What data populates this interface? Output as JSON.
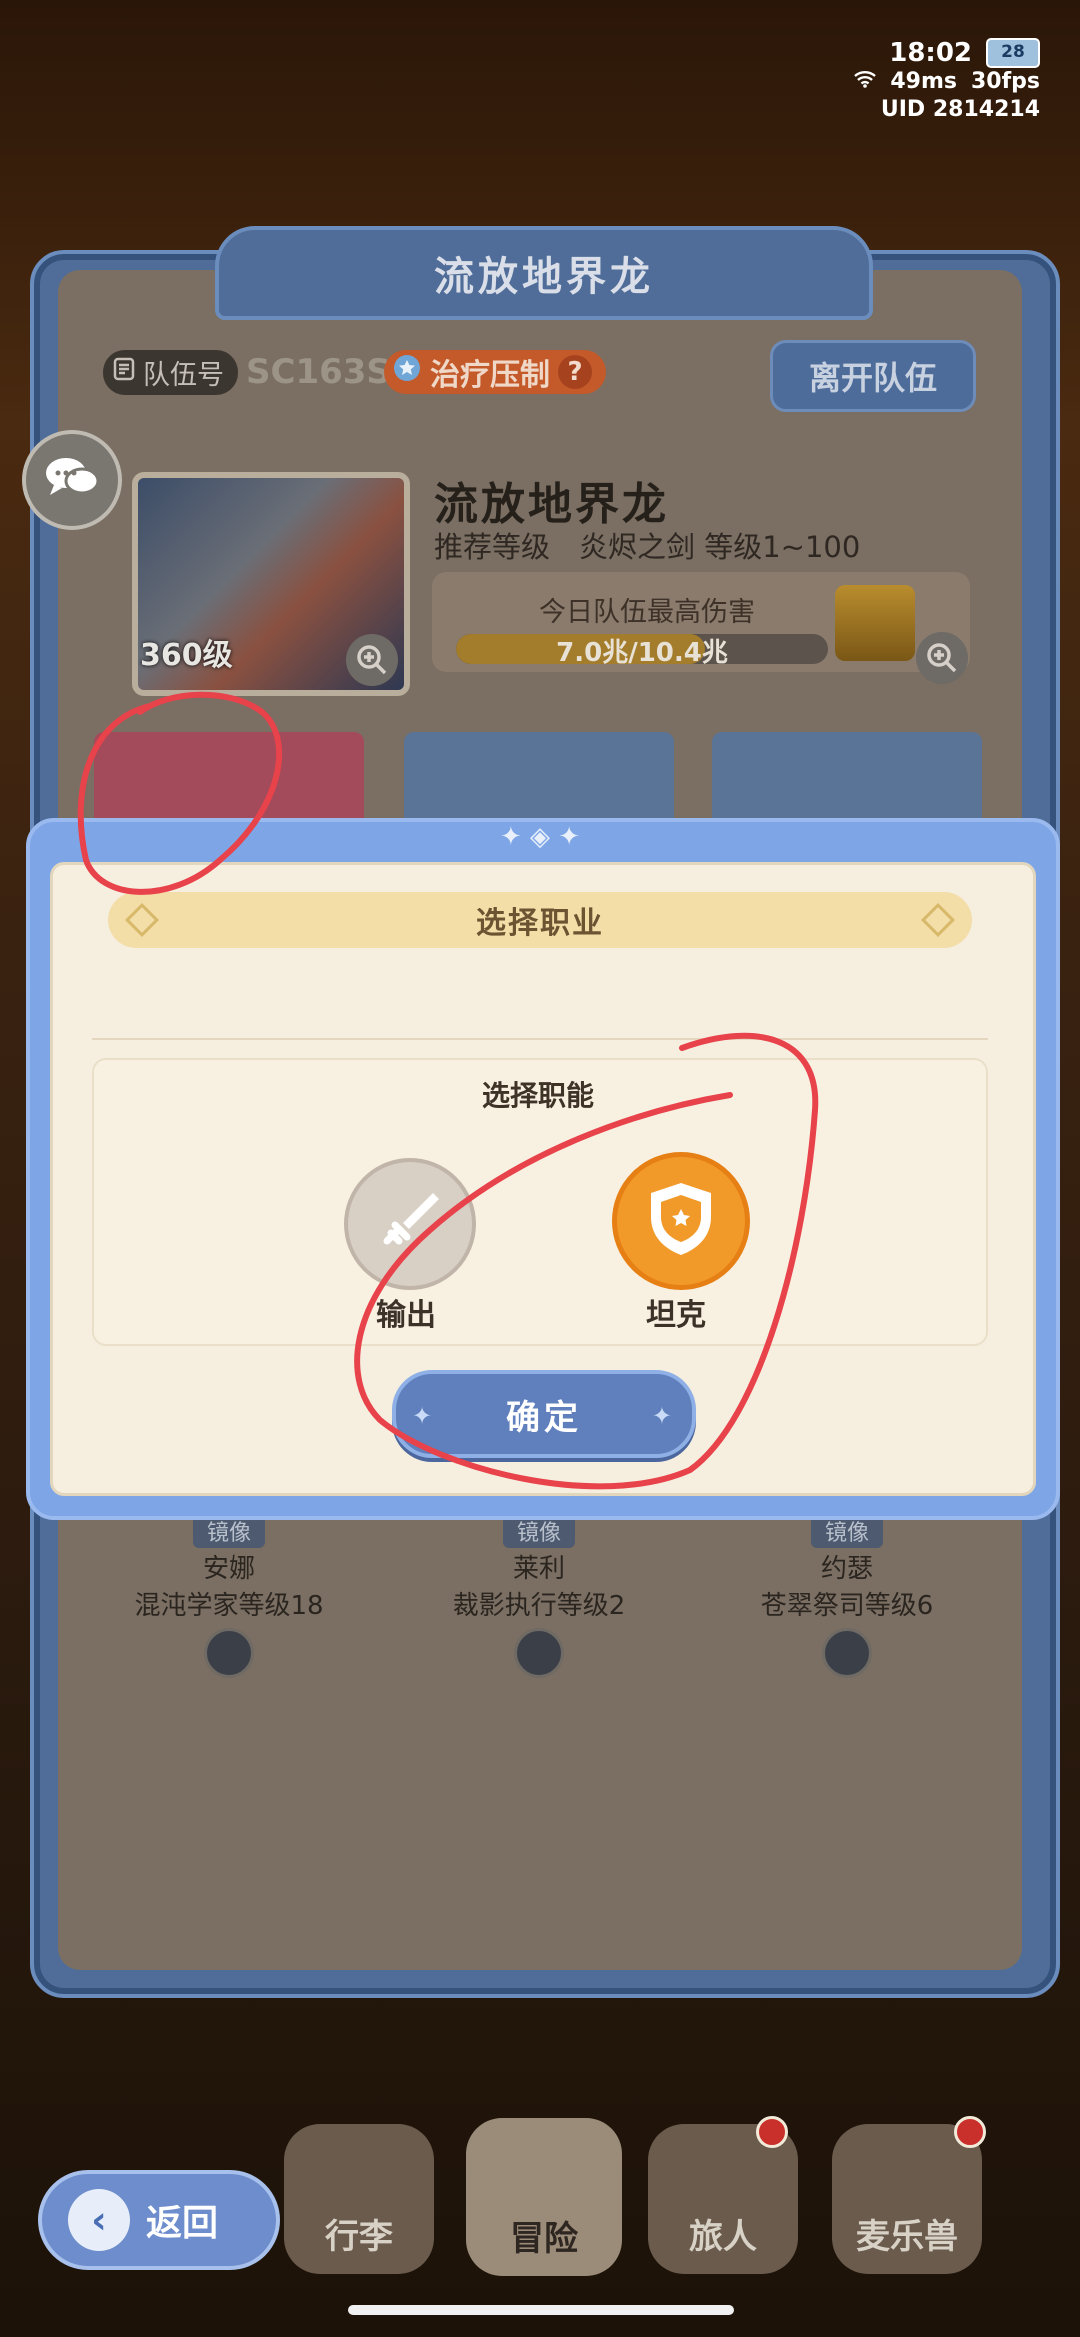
{
  "status": {
    "time": "18:02",
    "battery": "28",
    "ping": "49ms",
    "fps": "30fps",
    "uid": "UID 2814214"
  },
  "panel": {
    "title": "流放地界龙",
    "team_id_label": "队伍号",
    "team_code": "SC163S",
    "heal_label": "治疗压制",
    "heal_help": "?",
    "leave_button": "离开队伍"
  },
  "boss": {
    "name": "流放地界龙",
    "recommend": "推荐等级　炎烬之剑 等级1~100",
    "level_badge": "360级",
    "damage_label": "今日队伍最高伤害",
    "damage_text": "7.0兆/10.4兆",
    "damage_progress": 0.67
  },
  "members": [
    {
      "tag": "镜像",
      "name": "安娜",
      "class_level": "混沌学家等级18"
    },
    {
      "tag": "镜像",
      "name": "莱利",
      "class_level": "裁影执行等级2"
    },
    {
      "tag": "镜像",
      "name": "约瑟",
      "class_level": "苍翠祭司等级6"
    }
  ],
  "modal": {
    "title": "选择职业",
    "subtitle": "选择职能",
    "option_dps": "输出",
    "option_tank": "坦克",
    "confirm": "确定"
  },
  "nav": {
    "back": "返回",
    "items": [
      "行李",
      "冒险",
      "旅人",
      "麦乐兽"
    ]
  },
  "colors": {
    "modal_frame": "#7ea6e7",
    "tank_selected": "#f19a2a",
    "annotation_red": "#e8424b"
  }
}
